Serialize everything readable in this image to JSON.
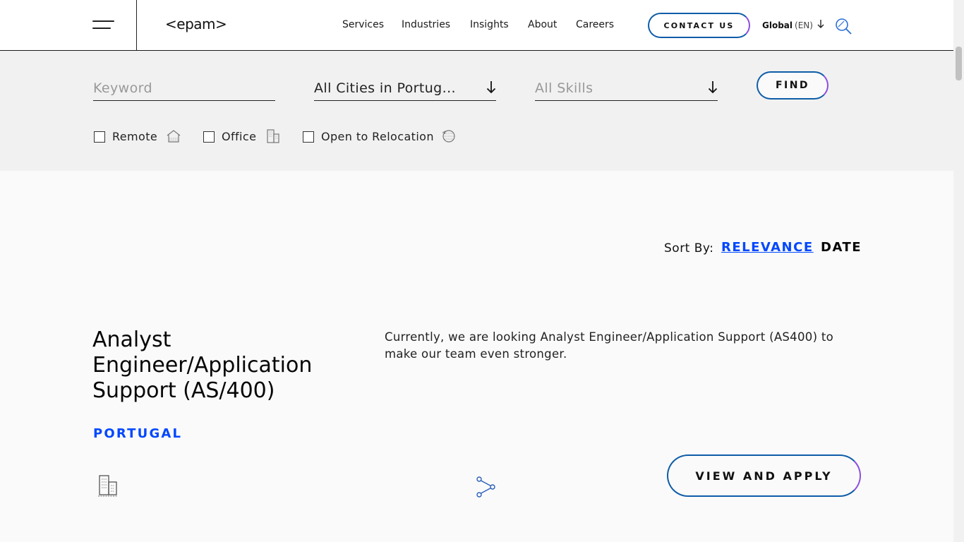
{
  "header": {
    "logo": "<epam>",
    "nav": [
      "Services",
      "Industries",
      "Insights",
      "About",
      "Careers"
    ],
    "contact_label": "CONTACT US",
    "lang_region": "Global",
    "lang_code": "(EN)"
  },
  "filters": {
    "keyword_placeholder": "Keyword",
    "city_value": "All Cities in Portug...",
    "skills_placeholder": "All Skills",
    "find_label": "FIND",
    "checkboxes": [
      {
        "label": "Remote",
        "icon": "home-icon",
        "checked": false
      },
      {
        "label": "Office",
        "icon": "office-building-icon",
        "checked": false
      },
      {
        "label": "Open to Relocation",
        "icon": "relocation-icon",
        "checked": false
      }
    ]
  },
  "sort": {
    "label": "Sort By:",
    "relevance": "RELEVANCE",
    "date": "DATE",
    "active": "RELEVANCE"
  },
  "job": {
    "title": "Analyst Engineer/Application Support (AS/400)",
    "location": "PORTUGAL",
    "description": "Currently, we are looking Analyst Engineer/Application Support (AS400) to make our team even stronger.",
    "work_mode_icon": "office-building-icon",
    "share_icon": "share-icon",
    "apply_label": "VIEW AND APPLY"
  },
  "colors": {
    "accent_blue": "#0047ff",
    "button_gradient_start": "#0f5da8",
    "button_gradient_end": "#8a4fe0"
  }
}
